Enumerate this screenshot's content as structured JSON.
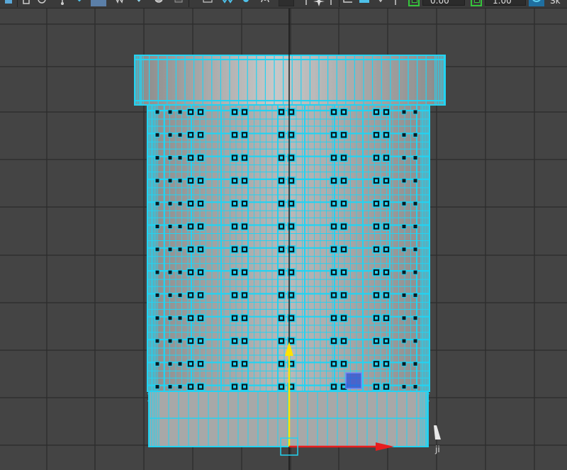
{
  "toolbar": {
    "field_one_value": "0.00",
    "field_two_value": "1.00",
    "trailing_label": "Sk"
  },
  "viewport": {
    "side_text": "ji",
    "background_color": "#444444",
    "grid_color": "#2e2e2e",
    "wire_color": "#22d3f2",
    "surface_color": "#a8a8a8",
    "axis_y_color": "#ffe400",
    "axis_x_color": "#e81d1d",
    "manipulator_color": "#2e4fd6"
  },
  "icons": [
    "snap-icon",
    "cube-wire-icon",
    "cube-shaded-icon",
    "lighting-icon",
    "camera-icon",
    "texture-icon",
    "render-icon",
    "grid-icon",
    "isolate-icon",
    "xray-icon",
    "gamma-icon",
    "exposure-icon",
    "color-manage-icon"
  ]
}
